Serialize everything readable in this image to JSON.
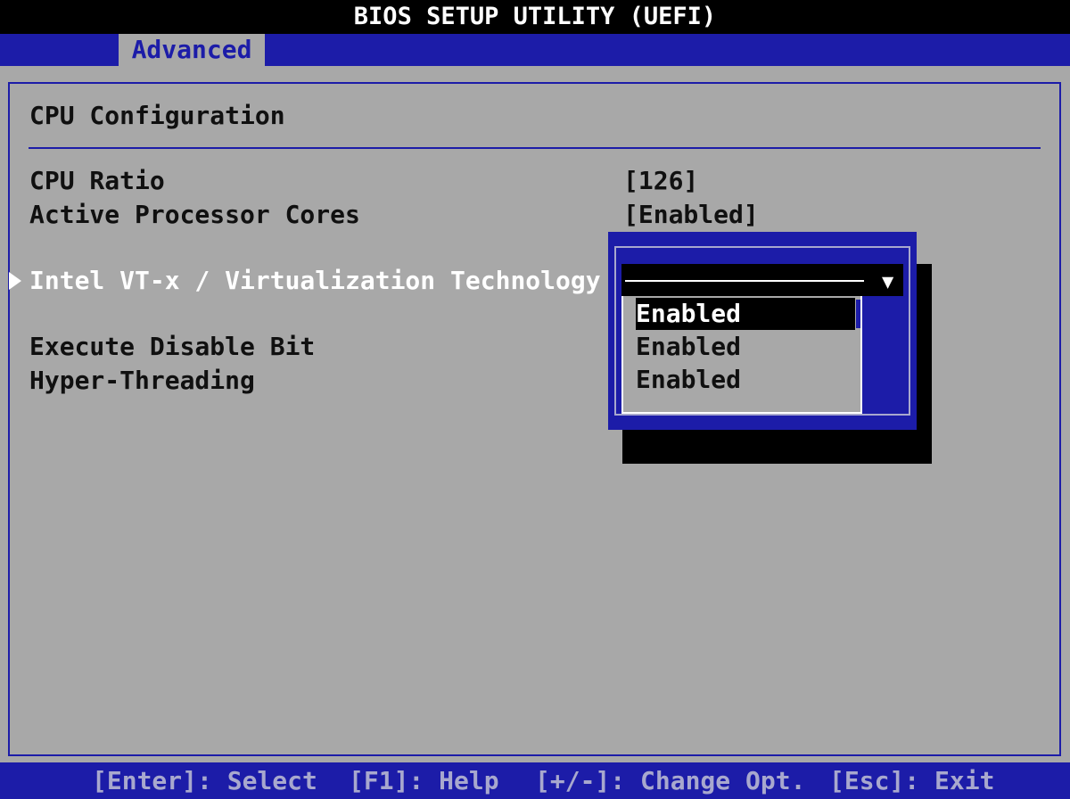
{
  "app": {
    "title": "BIOS SETUP UTILITY (UEFI)"
  },
  "tabs": [
    {
      "label": "Advanced",
      "active": true
    }
  ],
  "section": {
    "title": "CPU Configuration"
  },
  "settings": [
    {
      "label": "CPU Ratio",
      "value": "[126]"
    },
    {
      "label": "Active Processor Cores",
      "value": "[Enabled]"
    },
    {
      "label": "Intel VT-x / Virtualization Technology",
      "value": ""
    },
    {
      "label": "Execute Disable Bit",
      "value": ""
    },
    {
      "label": "Hyper-Threading",
      "value": ""
    }
  ],
  "popup": {
    "options": [
      {
        "label": "Enabled",
        "selected": true
      },
      {
        "label": "Enabled",
        "selected": false
      },
      {
        "label": "Enabled",
        "selected": false
      }
    ]
  },
  "hints": [
    {
      "label": "[Enter]: Select"
    },
    {
      "label": "[F1]: Help"
    },
    {
      "label": "[+/-]: Change Opt."
    },
    {
      "label": "[Esc]: Exit"
    }
  ],
  "colors": {
    "background": "#a8a8a8",
    "accent_blue": "#1c1ca8",
    "title_bar": "#000000",
    "highlight_text": "#ffffff"
  },
  "icons": {
    "pointer": "right-triangle-pointer",
    "dropdown": "down-triangle"
  }
}
